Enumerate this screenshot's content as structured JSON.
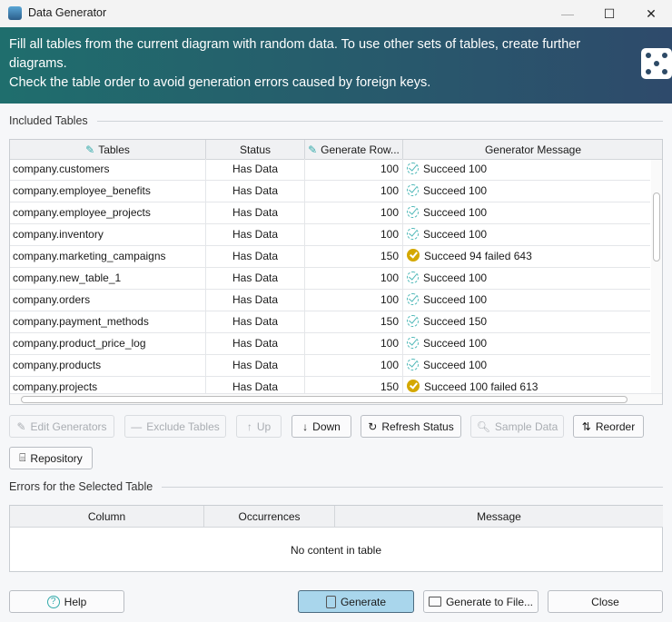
{
  "window": {
    "title": "Data Generator",
    "minimize": "—",
    "maximize": "☐",
    "close": "✕"
  },
  "banner": {
    "line1": "Fill all tables from the current diagram with random data. To use other sets of tables, create further diagrams.",
    "line2": "Check the table order to avoid generation errors caused by foreign keys.",
    "icon": "dice-icon"
  },
  "included": {
    "label": "Included Tables",
    "columns": [
      "Tables",
      "Status",
      "Generate Row...",
      "Generator Message"
    ],
    "rows": [
      {
        "table": "company.customers",
        "status": "Has Data",
        "rows": "100",
        "message": "Succeed 100",
        "state": "ok"
      },
      {
        "table": "company.employee_benefits",
        "status": "Has Data",
        "rows": "100",
        "message": "Succeed 100",
        "state": "ok"
      },
      {
        "table": "company.employee_projects",
        "status": "Has Data",
        "rows": "100",
        "message": "Succeed 100",
        "state": "ok"
      },
      {
        "table": "company.inventory",
        "status": "Has Data",
        "rows": "100",
        "message": "Succeed 100",
        "state": "ok"
      },
      {
        "table": "company.marketing_campaigns",
        "status": "Has Data",
        "rows": "150",
        "message": "Succeed 94 failed 643",
        "state": "warn"
      },
      {
        "table": "company.new_table_1",
        "status": "Has Data",
        "rows": "100",
        "message": "Succeed 100",
        "state": "ok"
      },
      {
        "table": "company.orders",
        "status": "Has Data",
        "rows": "100",
        "message": "Succeed 100",
        "state": "ok"
      },
      {
        "table": "company.payment_methods",
        "status": "Has Data",
        "rows": "150",
        "message": "Succeed 150",
        "state": "ok"
      },
      {
        "table": "company.product_price_log",
        "status": "Has Data",
        "rows": "100",
        "message": "Succeed 100",
        "state": "ok"
      },
      {
        "table": "company.products",
        "status": "Has Data",
        "rows": "100",
        "message": "Succeed 100",
        "state": "ok"
      },
      {
        "table": "company.projects",
        "status": "Has Data",
        "rows": "150",
        "message": "Succeed 100 failed 613",
        "state": "warn"
      }
    ]
  },
  "toolbar": {
    "edit": "Edit Generators",
    "exclude": "Exclude Tables",
    "up": "Up",
    "down": "Down",
    "refresh": "Refresh Status",
    "sample": "Sample Data",
    "reorder": "Reorder",
    "repository": "Repository"
  },
  "errors": {
    "label": "Errors for the Selected Table",
    "columns": [
      "Column",
      "Occurrences",
      "Message"
    ],
    "empty": "No content in table"
  },
  "footer": {
    "help": "Help",
    "generate": "Generate",
    "generate_file": "Generate to File...",
    "close": "Close"
  },
  "colors": {
    "accent": "#a9d6ec",
    "success": "#4fb8b8",
    "warning": "#d4a800"
  }
}
